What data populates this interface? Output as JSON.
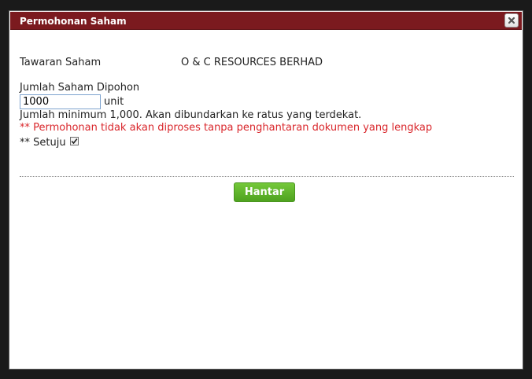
{
  "dialog": {
    "title": "Permohonan Saham",
    "close_icon": "close-icon"
  },
  "form": {
    "offer_label": "Tawaran Saham",
    "offer_value": "O & C RESOURCES BERHAD",
    "quantity_label": "Jumlah Saham Dipohon",
    "quantity_value": "1000",
    "unit_label": "unit",
    "minimum_note": "Jumlah minimum 1,000. Akan dibundarkan ke ratus yang terdekat.",
    "warning_note": "** Permohonan tidak akan diproses tanpa penghantaran dokumen yang lengkap",
    "agree_label": "** Setuju",
    "agree_checked": true,
    "submit_label": "Hantar"
  },
  "colors": {
    "titlebar": "#7b1a1f",
    "warning": "#d9262b",
    "submit": "#5cb02b"
  }
}
